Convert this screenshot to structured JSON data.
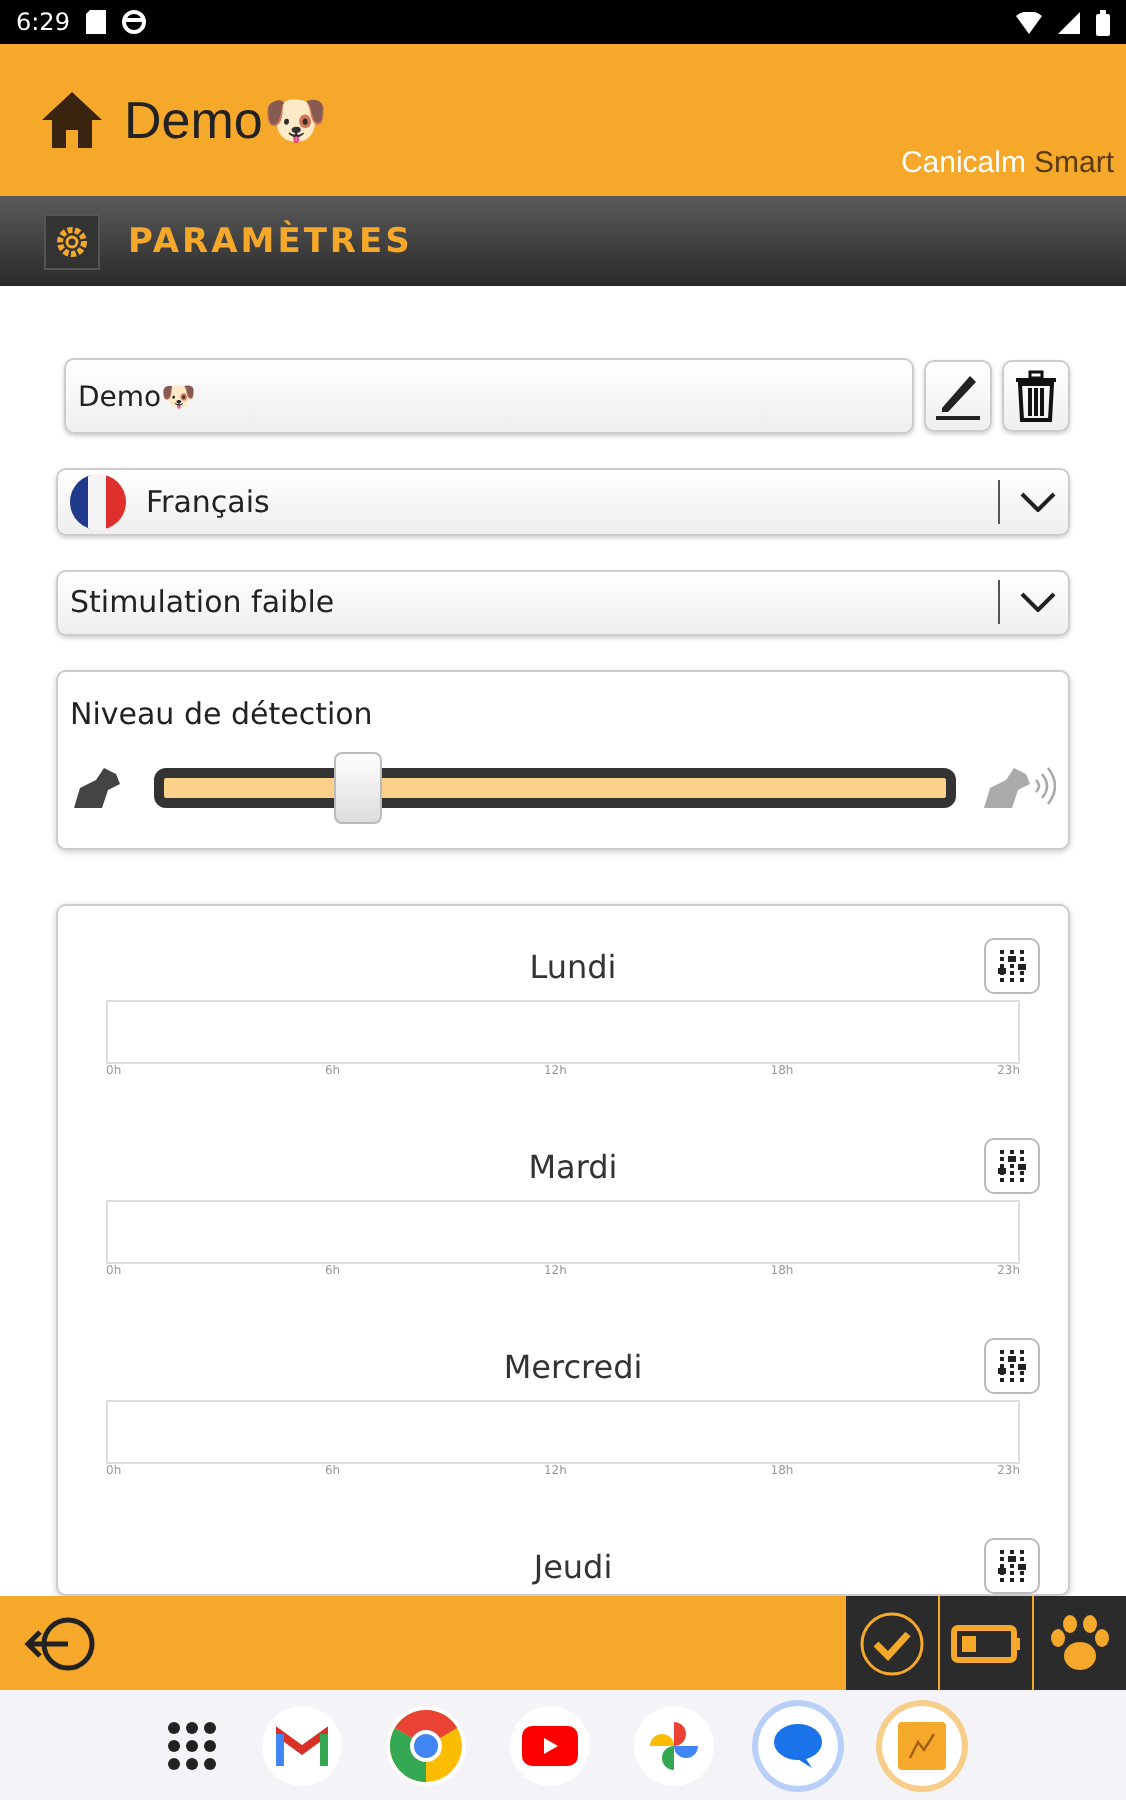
{
  "status_bar": {
    "time": "6:29"
  },
  "header": {
    "title": "Demo🐶",
    "brand": "Canicalm",
    "brand_suffix": "Smart"
  },
  "section": {
    "title": "PARAMÈTRES"
  },
  "name_field": {
    "value": "Demo🐶"
  },
  "language": {
    "value": "Français"
  },
  "mode": {
    "value": "Stimulation faible"
  },
  "detection": {
    "label": "Niveau de détection",
    "level": 0.245
  },
  "days": [
    {
      "name": "Lundi",
      "ticks": [
        "0h",
        "6h",
        "12h",
        "18h",
        "23h"
      ]
    },
    {
      "name": "Mardi",
      "ticks": [
        "0h",
        "6h",
        "12h",
        "18h",
        "23h"
      ]
    },
    {
      "name": "Mercredi",
      "ticks": [
        "0h",
        "6h",
        "12h",
        "18h",
        "23h"
      ]
    },
    {
      "name": "Jeudi"
    }
  ]
}
